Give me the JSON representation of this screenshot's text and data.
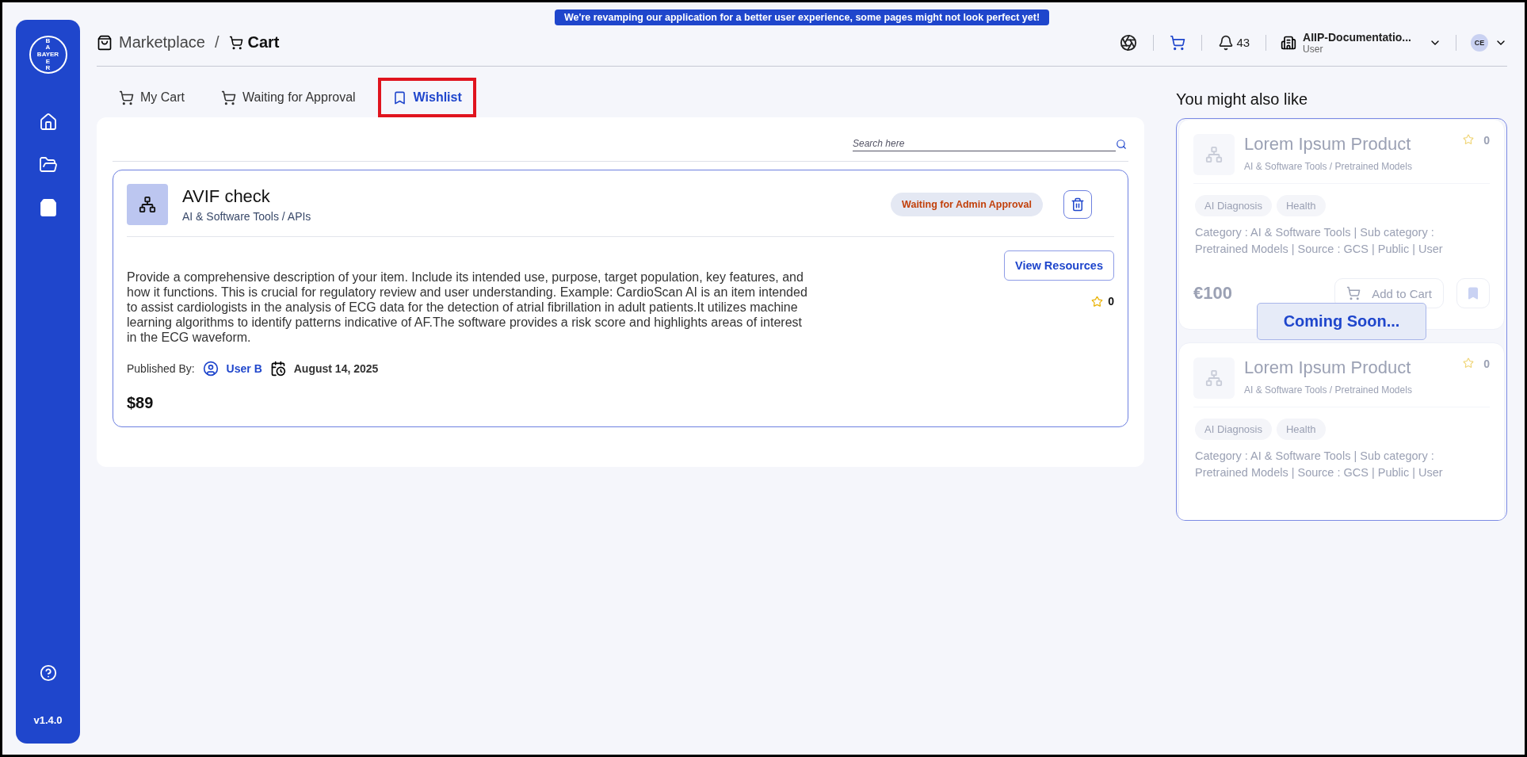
{
  "banner": "We're revamping our application for a better user experience, some pages might not look perfect yet!",
  "sidebar": {
    "logo": {
      "horizontal": "BAYER",
      "vertical_top": "BA",
      "vertical_bottom": "ER"
    },
    "nav_items": [
      {
        "kind": "home",
        "selected": false
      },
      {
        "kind": "folder",
        "selected": false
      },
      {
        "kind": "marketplace",
        "selected": true
      }
    ],
    "version": "v1.4.0"
  },
  "breadcrumb": {
    "items": [
      "Marketplace",
      "Cart"
    ],
    "separator": "/"
  },
  "header": {
    "notifications": "43",
    "account": {
      "name": "AIIP-Documentatio...",
      "role": "User"
    },
    "avatar": "CE"
  },
  "tabs": [
    {
      "label": "My Cart",
      "kind": "cart",
      "selected": false,
      "highlighted": false
    },
    {
      "label": "Waiting for Approval",
      "kind": "cart",
      "selected": false,
      "highlighted": false
    },
    {
      "label": "Wishlist",
      "kind": "bookmark",
      "selected": true,
      "highlighted": true
    }
  ],
  "search": {
    "placeholder": "Search here"
  },
  "items": [
    {
      "title": "AVIF check",
      "category": "AI & Software Tools / APIs",
      "status": "Waiting for Admin Approval",
      "description": "Provide a comprehensive description of your item. Include its intended use, purpose, target population, key features, and how it functions. This is crucial for regulatory review and user understanding. Example: CardioScan AI is an item intended to assist cardiologists in the analysis of ECG data for the detection of atrial fibrillation in adult patients.It utilizes machine learning algorithms to identify patterns indicative of AF.The software provides a risk score and highlights areas of interest in the ECG waveform.",
      "published_label": "Published By:",
      "publisher": "User B",
      "date": "August 14, 2025",
      "button": "View Resources",
      "rating": "0",
      "price": "$89"
    }
  ],
  "recommendations": {
    "title": "You might also like",
    "overlay": "Coming Soon...",
    "cards": [
      {
        "title": "Lorem Ipsum Product",
        "rating": "0",
        "category": "AI & Software Tools / Pretrained Models",
        "tags": [
          "AI Diagnosis",
          "Health"
        ],
        "details": "Category : AI & Software Tools | Sub category : Pretrained Models | Source : GCS | Public | User",
        "price": "€100",
        "button": "Add to Cart"
      },
      {
        "title": "Lorem Ipsum Product",
        "rating": "0",
        "category": "AI & Software Tools / Pretrained Models",
        "tags": [
          "AI Diagnosis",
          "Health"
        ],
        "details": "Category : AI & Software Tools | Sub category : Pretrained Models | Source : GCS | Public | User"
      }
    ]
  }
}
